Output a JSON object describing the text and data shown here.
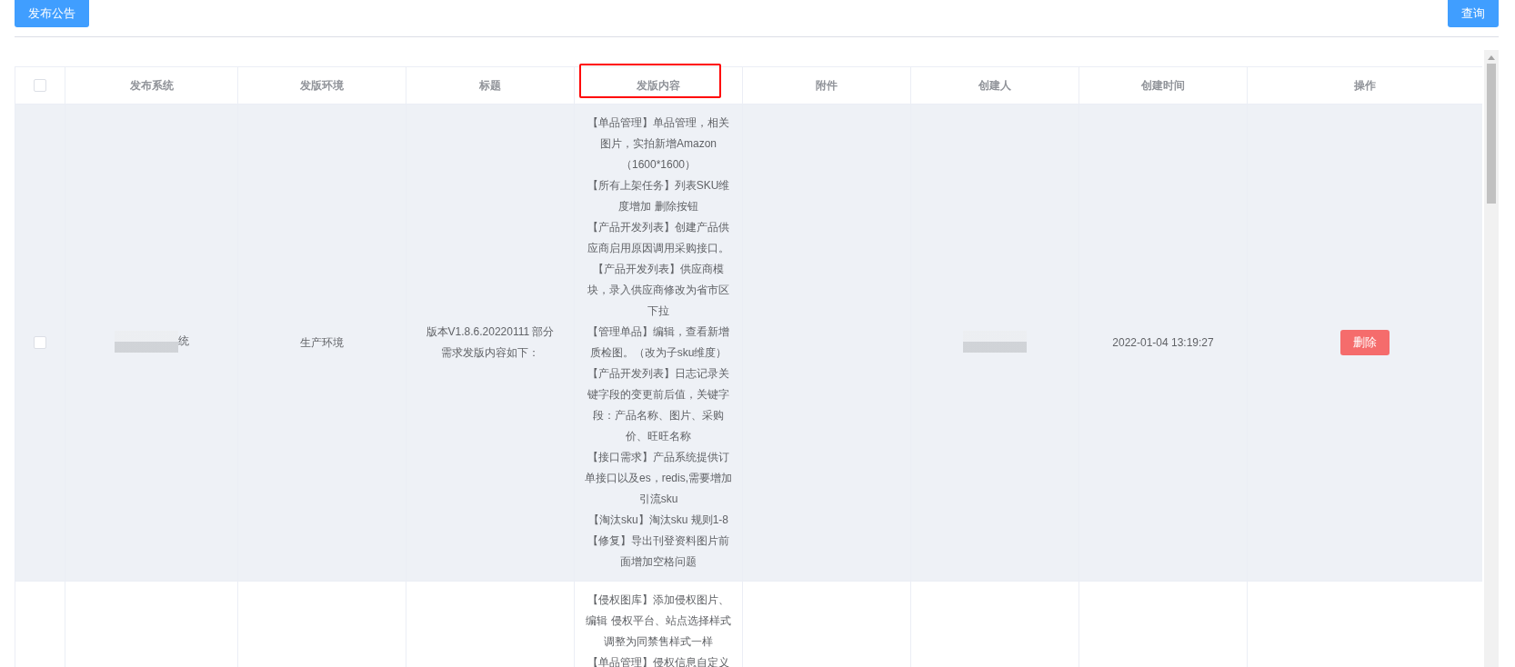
{
  "toolbar": {
    "publish_button": "发布公告",
    "query_button": "查询"
  },
  "table": {
    "select_all": {
      "checked": false
    },
    "columns": [
      {
        "label": "发布系统",
        "outlined": false
      },
      {
        "label": "发版环境",
        "outlined": false
      },
      {
        "label": "标题",
        "outlined": false
      },
      {
        "label": "发版内容",
        "outlined": true
      },
      {
        "label": "附件",
        "outlined": false
      },
      {
        "label": "创建人",
        "outlined": false
      },
      {
        "label": "创建时间",
        "outlined": false
      },
      {
        "label": "操作",
        "outlined": false
      }
    ],
    "rows": [
      {
        "highlighted": true,
        "checkbox": {
          "checked": false
        },
        "system": {
          "text": "统",
          "redacted": true
        },
        "environment": "生产环境",
        "title": "版本V1.8.6.20220111 部分需求发版内容如下：",
        "content": [
          "【单品管理】单品管理，相关图片，实拍新增Amazon（1600*1600）",
          "【所有上架任务】列表SKU维度增加 删除按钮",
          "【产品开发列表】创建产品供应商启用原因调用采购接口。",
          "【产品开发列表】供应商模块，录入供应商修改为省市区下拉",
          "【管理单品】编辑，查看新增质检图。（改为子sku维度）",
          "【产品开发列表】日志记录关键字段的变更前后值，关键字段：产品名称、图片、采购价、旺旺名称",
          "【接口需求】产品系统提供订单接口以及es，redis,需要增加引流sku",
          "【淘汰sku】淘汰sku 规则1-8",
          "【修复】导出刊登资料图片前面增加空格问题"
        ],
        "creator": {
          "redacted": true
        },
        "created_at": "2022-01-04 13:19:27",
        "actions": [
          "删除"
        ]
      },
      {
        "highlighted": false,
        "content": [
          "【侵权图库】添加侵权图片、编辑 侵权平台、站点选择样式调整为同禁售样式一样",
          "【单品管理】侵权信息自定义"
        ]
      }
    ]
  }
}
